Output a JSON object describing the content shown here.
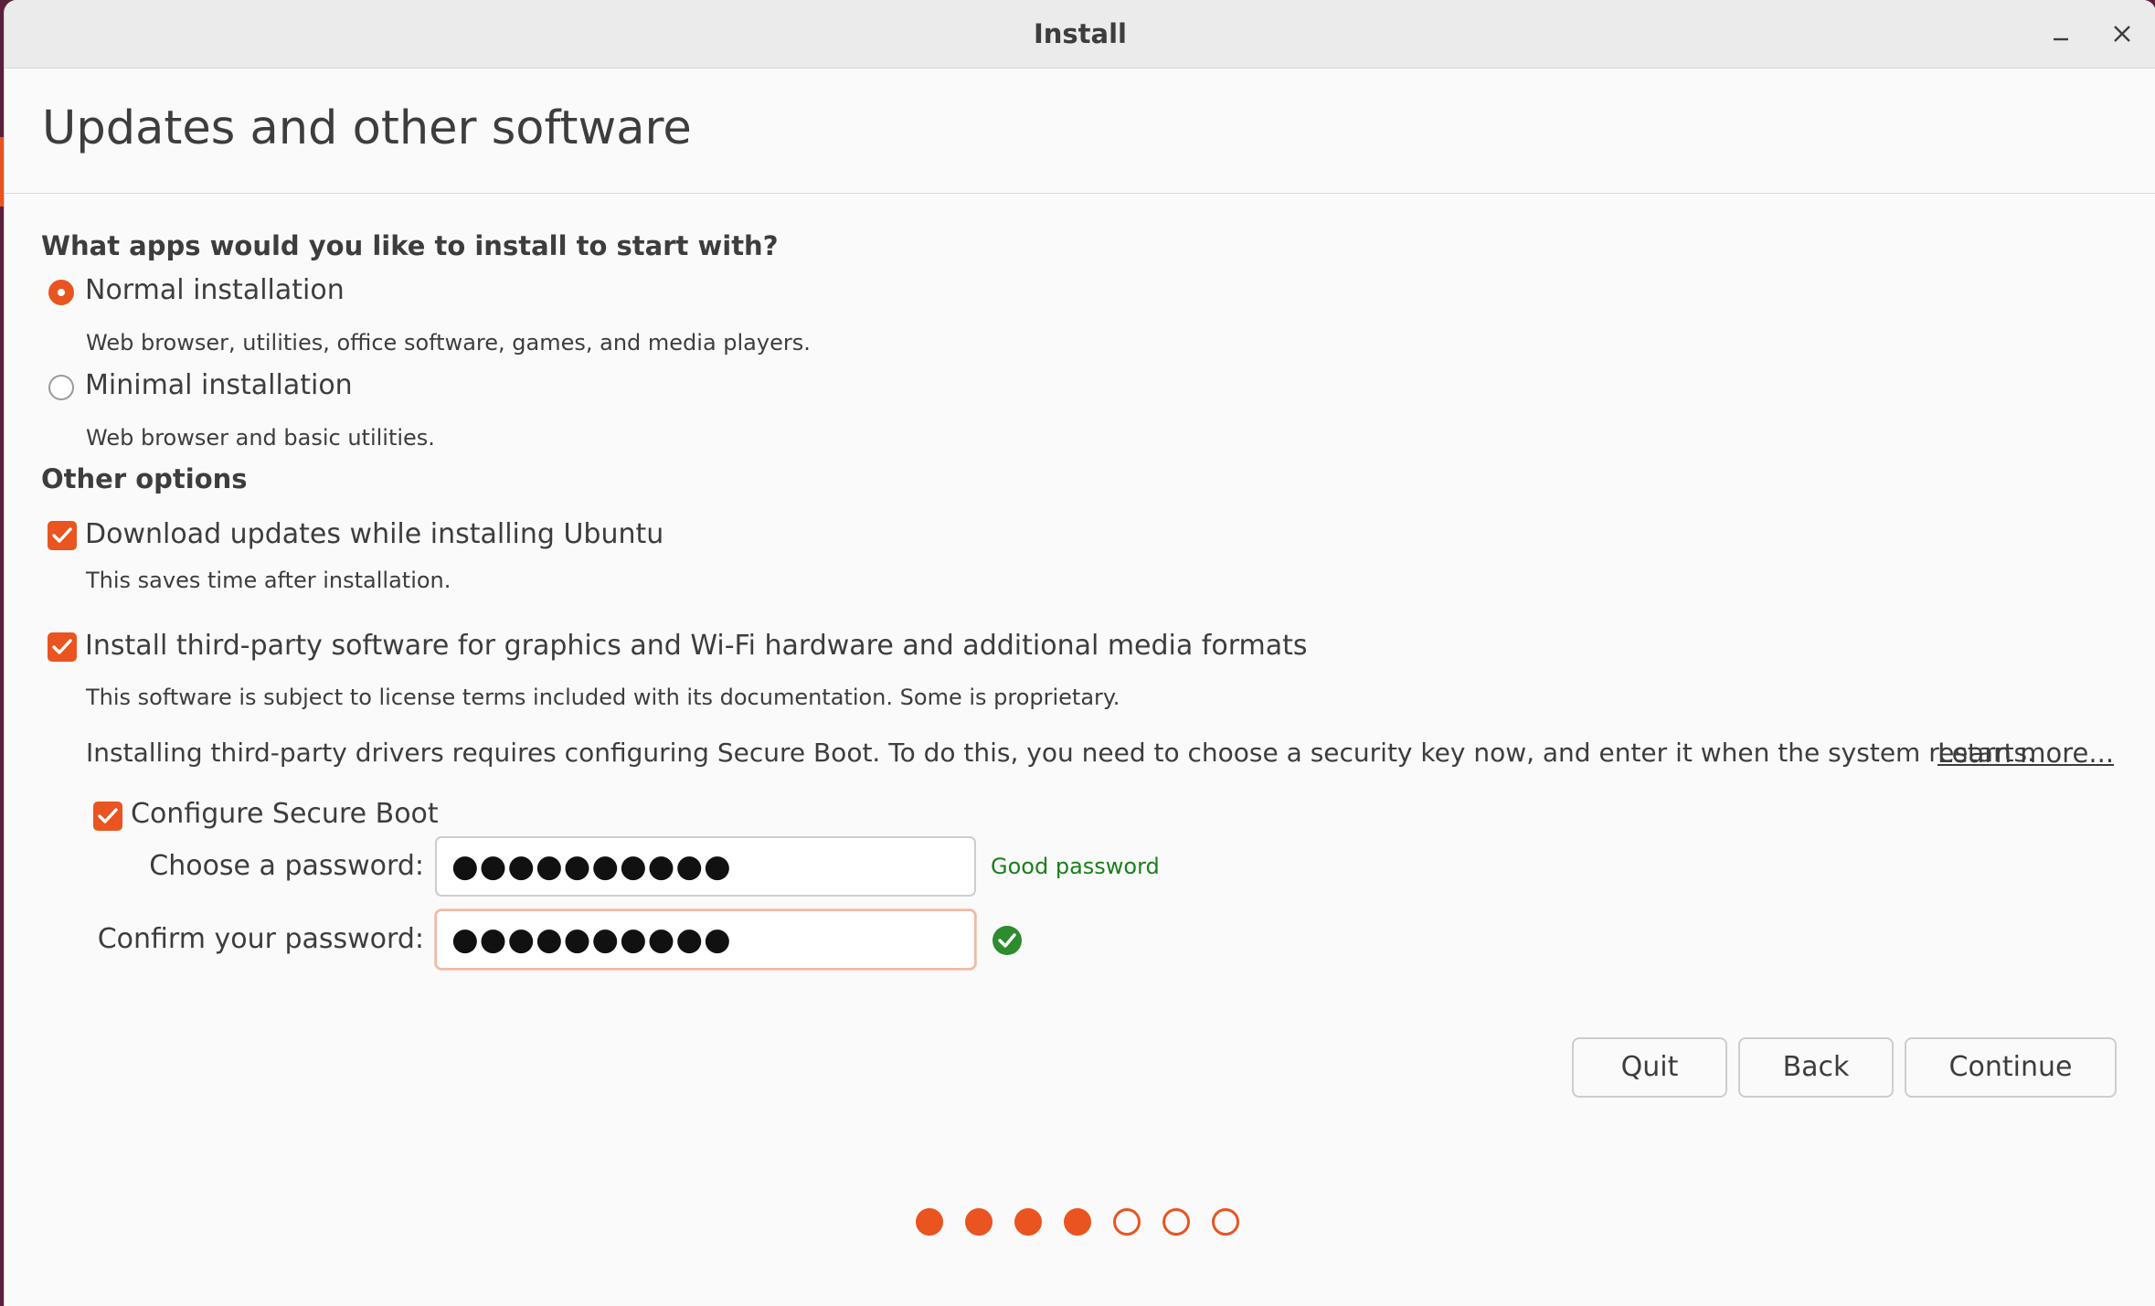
{
  "window": {
    "title": "Install"
  },
  "page": {
    "heading": "Updates and other software"
  },
  "apps_section": {
    "title": "What apps would you like to install to start with?",
    "options": [
      {
        "label": "Normal installation",
        "description": "Web browser, utilities, office software, games, and media players.",
        "selected": true
      },
      {
        "label": "Minimal installation",
        "description": "Web browser and basic utilities.",
        "selected": false
      }
    ]
  },
  "other_section": {
    "title": "Other options",
    "download_updates": {
      "label": "Download updates while installing Ubuntu",
      "description": "This saves time after installation.",
      "checked": true
    },
    "third_party": {
      "label": "Install third-party software for graphics and Wi-Fi hardware and additional media formats",
      "description": "This software is subject to license terms included with its documentation. Some is proprietary.",
      "checked": true
    },
    "secure_boot_note": "Installing third-party drivers requires configuring Secure Boot. To do this, you need to choose a security key now, and enter it when the system restarts.",
    "learn_more": "Learn more...",
    "secure_boot": {
      "label": "Configure Secure Boot",
      "checked": true,
      "password_label": "Choose a password:",
      "password_value": "●●●●●●●●●●",
      "password_strength": "Good password",
      "confirm_label": "Confirm your password:",
      "confirm_value": "●●●●●●●●●●"
    }
  },
  "buttons": {
    "quit": "Quit",
    "back": "Back",
    "continue": "Continue"
  },
  "progress": {
    "total_steps": 7,
    "completed_steps": 4
  },
  "colors": {
    "accent": "#e95420",
    "success": "#2e8b2e",
    "strength_text": "#1a7f1a"
  }
}
